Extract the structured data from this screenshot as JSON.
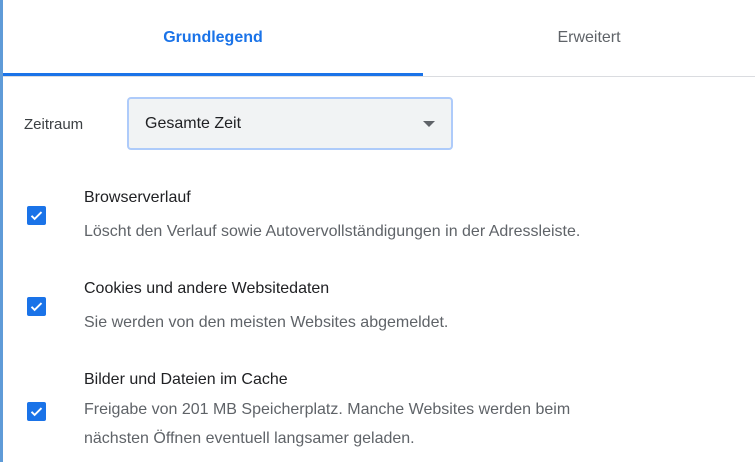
{
  "tabs": [
    {
      "label": "Grundlegend",
      "active": true
    },
    {
      "label": "Erweitert",
      "active": false
    }
  ],
  "time_range": {
    "label": "Zeitraum",
    "value": "Gesamte Zeit"
  },
  "options": [
    {
      "title": "Browserverlauf",
      "description": "Löscht den Verlauf sowie Autovervollständigungen in der Adressleiste.",
      "checked": true
    },
    {
      "title": "Cookies und andere Websitedaten",
      "description": "Sie werden von den meisten Websites abgemeldet.",
      "checked": true
    },
    {
      "title": "Bilder und Dateien im Cache",
      "description": "Freigabe von 201 MB Speicherplatz. Manche Websites werden beim",
      "description_line2": "nächsten Öffnen eventuell langsamer geladen.",
      "checked": true
    }
  ],
  "colors": {
    "accent": "#1a73e8",
    "select_border": "#aecbfa",
    "select_bg": "#f1f3f4"
  }
}
